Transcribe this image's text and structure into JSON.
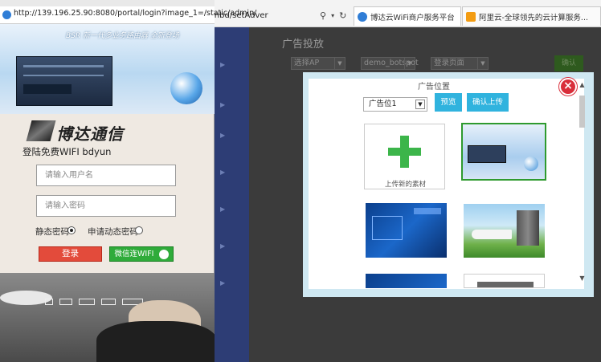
{
  "main_browser": {
    "address_tail": "inbd/setAdver",
    "tabs": [
      {
        "label": "博达云WiFi商户服务平台",
        "close": "×"
      },
      {
        "label": "阿里云-全球领先的云计算服务...",
        "close": ""
      }
    ]
  },
  "admin": {
    "page_title": "广告投放",
    "filters": {
      "ap_select": "选择AP",
      "ssid_select": "demo_botspot",
      "page_select": "登录页面"
    },
    "confirm_button": "确认"
  },
  "modal": {
    "title": "广告位置",
    "position_select": "广告位1",
    "preview_button": "预览",
    "upload_button": "确认上传",
    "upload_tile_label": "上传新的素材",
    "close_symbol": "×"
  },
  "popup": {
    "url": "http://139.196.25.90:8080/portal/login?image_1=/static/admin/",
    "banner_headline": "BSR 新一代多业务路由器 全新登场",
    "brand": "博达通信",
    "welcome": "登陆免费WIFI bdyun",
    "username_placeholder": "请输入用户名",
    "password_placeholder": "请输入密码",
    "static_pwd_label": "静态密码",
    "dynamic_pwd_label": "申请动态密码",
    "login_button": "登录",
    "wechat_button": "微信连WIFI",
    "selected_mode": "static"
  },
  "colors": {
    "accent_blue": "#30b3de",
    "login_red": "#e34b3b",
    "wechat_green": "#2fab3a",
    "close_red": "#d92e3a",
    "plus_green": "#3cb54a"
  }
}
